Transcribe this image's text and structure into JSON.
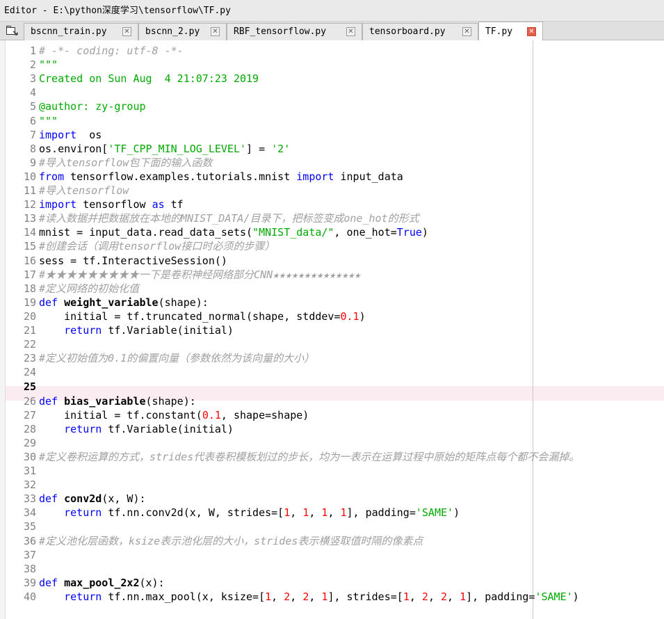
{
  "window": {
    "title": "Editor - E:\\python深度学习\\tensorflow\\TF.py"
  },
  "tabs": [
    {
      "label": "bscnn_train.py",
      "active": false
    },
    {
      "label": "bscnn_2.py",
      "active": false
    },
    {
      "label": "RBF_tensorflow.py",
      "active": false
    },
    {
      "label": "tensorboard.py",
      "active": false
    },
    {
      "label": "TF.py",
      "active": true
    }
  ],
  "tab_close_glyph": "✕",
  "colors": {
    "comment": "#a0a0a0",
    "string": "#00aa00",
    "keyword": "#0000ff",
    "number": "#ff0000",
    "current_line": "#fbecf2"
  },
  "editor": {
    "current_line": 25,
    "lines": [
      {
        "n": "1",
        "t": [
          [
            "cm",
            "# -*- coding: utf-8 -*-"
          ]
        ]
      },
      {
        "n": "2",
        "t": [
          [
            "str",
            "\"\"\""
          ]
        ]
      },
      {
        "n": "3",
        "t": [
          [
            "str",
            "Created on Sun Aug  4 21:07:23 2019"
          ]
        ]
      },
      {
        "n": "4",
        "t": [
          [
            "str",
            ""
          ]
        ]
      },
      {
        "n": "5",
        "t": [
          [
            "str",
            "@author: zy-group"
          ]
        ]
      },
      {
        "n": "6",
        "t": [
          [
            "str",
            "\"\"\""
          ]
        ]
      },
      {
        "n": "7",
        "t": [
          [
            "kw",
            "import"
          ],
          [
            "",
            "  os"
          ]
        ]
      },
      {
        "n": "8",
        "t": [
          [
            "",
            "os.environ["
          ],
          [
            "str",
            "'TF_CPP_MIN_LOG_LEVEL'"
          ],
          [
            "",
            "] = "
          ],
          [
            "str",
            "'2'"
          ]
        ]
      },
      {
        "n": "9",
        "t": [
          [
            "cm",
            "#导入tensorflow包下面的输入函数"
          ]
        ]
      },
      {
        "n": "10",
        "t": [
          [
            "kw",
            "from"
          ],
          [
            "",
            " tensorflow.examples.tutorials.mnist "
          ],
          [
            "kw",
            "import"
          ],
          [
            "",
            " input_data"
          ]
        ]
      },
      {
        "n": "11",
        "t": [
          [
            "cm",
            "#导入tensorflow"
          ]
        ]
      },
      {
        "n": "12",
        "t": [
          [
            "kw",
            "import"
          ],
          [
            "",
            " tensorflow "
          ],
          [
            "kw",
            "as"
          ],
          [
            "",
            " tf"
          ]
        ]
      },
      {
        "n": "13",
        "t": [
          [
            "cm",
            "#读入数据并把数据放在本地的MNIST_DATA/目录下，把标签变成one_hot的形式"
          ]
        ]
      },
      {
        "n": "14",
        "t": [
          [
            "",
            "mnist = input_data.read_data_sets("
          ],
          [
            "str",
            "\"MNIST_data/\""
          ],
          [
            "",
            ", one_hot="
          ],
          [
            "kw",
            "True"
          ],
          [
            "",
            ")"
          ]
        ]
      },
      {
        "n": "15",
        "t": [
          [
            "cm",
            "#创建会话（调用tensorflow接口时必须的步骤）"
          ]
        ]
      },
      {
        "n": "16",
        "t": [
          [
            "",
            "sess = tf.InteractiveSession()"
          ]
        ]
      },
      {
        "n": "17",
        "t": [
          [
            "cm",
            "#★★★★★★★★★一下是卷积神经网络部分CNN★★★★★★★★★★★★★★"
          ]
        ]
      },
      {
        "n": "18",
        "t": [
          [
            "cm",
            "#定义网络的初始化值"
          ]
        ]
      },
      {
        "n": "19",
        "t": [
          [
            "kw",
            "def"
          ],
          [
            "",
            " "
          ],
          [
            "fn",
            "weight_variable"
          ],
          [
            "",
            "(shape):"
          ]
        ]
      },
      {
        "n": "20",
        "t": [
          [
            "",
            "    initial = tf.truncated_normal(shape, stddev="
          ],
          [
            "num",
            "0.1"
          ],
          [
            "",
            ")"
          ]
        ]
      },
      {
        "n": "21",
        "t": [
          [
            "",
            "    "
          ],
          [
            "kw",
            "return"
          ],
          [
            "",
            " tf.Variable(initial)"
          ]
        ]
      },
      {
        "n": "22",
        "t": [
          [
            "",
            ""
          ]
        ]
      },
      {
        "n": "23",
        "t": [
          [
            "cm",
            "#定义初始值为0.1的偏置向量（参数依然为该向量的大小）"
          ]
        ]
      },
      {
        "n": "24",
        "t": [
          [
            "",
            ""
          ]
        ]
      },
      {
        "n": "25",
        "t": [
          [
            "",
            ""
          ]
        ]
      },
      {
        "n": "26",
        "t": [
          [
            "kw",
            "def"
          ],
          [
            "",
            " "
          ],
          [
            "fn",
            "bias_variable"
          ],
          [
            "",
            "(shape):"
          ]
        ]
      },
      {
        "n": "27",
        "t": [
          [
            "",
            "    initial = tf.constant("
          ],
          [
            "num",
            "0.1"
          ],
          [
            "",
            ", shape=shape)"
          ]
        ]
      },
      {
        "n": "28",
        "t": [
          [
            "",
            "    "
          ],
          [
            "kw",
            "return"
          ],
          [
            "",
            " tf.Variable(initial)"
          ]
        ]
      },
      {
        "n": "29",
        "t": [
          [
            "",
            ""
          ]
        ]
      },
      {
        "n": "30",
        "t": [
          [
            "cm",
            "#定义卷积运算的方式，strides代表卷积模板划过的步长，均为一表示在运算过程中原始的矩阵点每个都不会漏掉。"
          ]
        ]
      },
      {
        "n": "31",
        "t": [
          [
            "",
            ""
          ]
        ]
      },
      {
        "n": "32",
        "t": [
          [
            "",
            ""
          ]
        ]
      },
      {
        "n": "33",
        "t": [
          [
            "kw",
            "def"
          ],
          [
            "",
            " "
          ],
          [
            "fn",
            "conv2d"
          ],
          [
            "",
            "(x, W):"
          ]
        ]
      },
      {
        "n": "34",
        "t": [
          [
            "",
            "    "
          ],
          [
            "kw",
            "return"
          ],
          [
            "",
            " tf.nn.conv2d(x, W, strides=["
          ],
          [
            "num",
            "1"
          ],
          [
            "",
            ", "
          ],
          [
            "num",
            "1"
          ],
          [
            "",
            ", "
          ],
          [
            "num",
            "1"
          ],
          [
            "",
            ", "
          ],
          [
            "num",
            "1"
          ],
          [
            "",
            "], padding="
          ],
          [
            "str",
            "'SAME'"
          ],
          [
            "",
            ")"
          ]
        ]
      },
      {
        "n": "35",
        "t": [
          [
            "",
            ""
          ]
        ]
      },
      {
        "n": "36",
        "t": [
          [
            "cm",
            "#定义池化层函数，ksize表示池化层的大小，strides表示横竖取值时隔的像素点"
          ]
        ]
      },
      {
        "n": "37",
        "t": [
          [
            "",
            ""
          ]
        ]
      },
      {
        "n": "38",
        "t": [
          [
            "",
            ""
          ]
        ]
      },
      {
        "n": "39",
        "t": [
          [
            "kw",
            "def"
          ],
          [
            "",
            " "
          ],
          [
            "fn",
            "max_pool_2x2"
          ],
          [
            "",
            "(x):"
          ]
        ]
      },
      {
        "n": "40",
        "t": [
          [
            "",
            "    "
          ],
          [
            "kw",
            "return"
          ],
          [
            "",
            " tf.nn.max_pool(x, ksize=["
          ],
          [
            "num",
            "1"
          ],
          [
            "",
            ", "
          ],
          [
            "num",
            "2"
          ],
          [
            "",
            ", "
          ],
          [
            "num",
            "2"
          ],
          [
            "",
            ", "
          ],
          [
            "num",
            "1"
          ],
          [
            "",
            "], strides=["
          ],
          [
            "num",
            "1"
          ],
          [
            "",
            ", "
          ],
          [
            "num",
            "2"
          ],
          [
            "",
            ", "
          ],
          [
            "num",
            "2"
          ],
          [
            "",
            ", "
          ],
          [
            "num",
            "1"
          ],
          [
            "",
            "], padding="
          ],
          [
            "str",
            "'SAME'"
          ],
          [
            "",
            ")"
          ]
        ]
      }
    ]
  }
}
